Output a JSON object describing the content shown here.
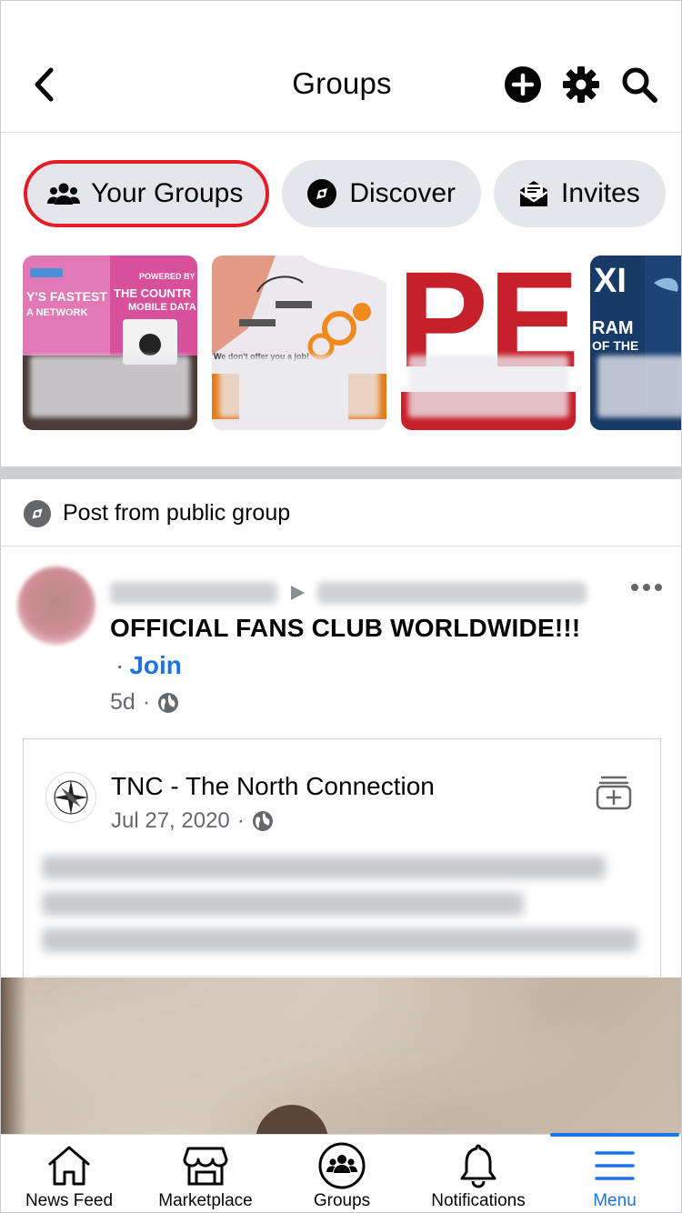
{
  "header": {
    "title": "Groups"
  },
  "pills": [
    {
      "label": "Your Groups",
      "icon": "people-icon"
    },
    {
      "label": "Discover",
      "icon": "compass-icon"
    },
    {
      "label": "Invites",
      "icon": "envelope-icon"
    }
  ],
  "thumbnails": [
    {
      "texts": [
        "Y'S FASTEST",
        "A NETWORK",
        "POWERED BY",
        "THE COUNTR",
        "MOBILE DATA"
      ]
    },
    {
      "texts": [
        "We don't offer you a job!"
      ]
    },
    {
      "texts": [
        "PE"
      ]
    },
    {
      "texts": [
        "XI",
        "RAM",
        "OF THE"
      ]
    }
  ],
  "section": {
    "label": "Post from public group"
  },
  "post": {
    "title": "OFFICIAL FANS CLUB WORLDWIDE!!!",
    "dot": "·",
    "join": "Join",
    "time": "5d",
    "meta_sep": "·"
  },
  "shared": {
    "title": "TNC - The North Connection",
    "date": "Jul 27, 2020",
    "sep": "·"
  },
  "tabs": [
    {
      "label": "News Feed",
      "icon": "home-icon"
    },
    {
      "label": "Marketplace",
      "icon": "store-icon"
    },
    {
      "label": "Groups",
      "icon": "groups-icon"
    },
    {
      "label": "Notifications",
      "icon": "bell-icon"
    },
    {
      "label": "Menu",
      "icon": "hamburger-icon"
    }
  ],
  "colors": {
    "accent": "#1b74e4",
    "highlight": "#e41e26",
    "pill_bg": "#e4e6eb"
  }
}
